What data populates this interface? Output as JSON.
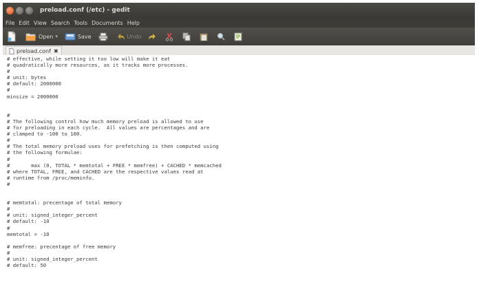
{
  "window": {
    "title": "preload.conf (/etc) - gedit"
  },
  "menubar": [
    "File",
    "Edit",
    "View",
    "Search",
    "Tools",
    "Documents",
    "Help"
  ],
  "toolbar": {
    "open_label": "Open",
    "save_label": "Save",
    "undo_label": "Undo"
  },
  "tab": {
    "label": "preload.conf"
  },
  "editor": {
    "lines": [
      "# effective, while setting it too low will make it eat",
      "# quadratically more resources, as it tracks more processes.",
      "#",
      "# unit: bytes",
      "# default: 2000000",
      "#",
      "minsize = 2000000",
      "",
      "",
      "#",
      "# The following control how much memory preload is allowed to use",
      "# for preloading in each cycle.  All values are percentages and are",
      "# clamped to -100 to 100.",
      "#",
      "# The total memory preload uses for prefetching is then computed using",
      "# the following formulae:",
      "#",
      "#       max (0, TOTAL * memtotal + FREE * memfree) + CACHED * memcached",
      "# where TOTAL, FREE, and CACHED are the respective values read at",
      "# runtime from /proc/meminfo.",
      "#",
      "",
      "",
      "# memtotal: precentage of total memory",
      "#",
      "# unit: signed_integer_percent",
      "# default: -10",
      "#",
      "memtotal = -10",
      "",
      "# memfree: precentage of free memory",
      "#",
      "# unit: signed_integer_percent",
      "# default: 50"
    ]
  }
}
